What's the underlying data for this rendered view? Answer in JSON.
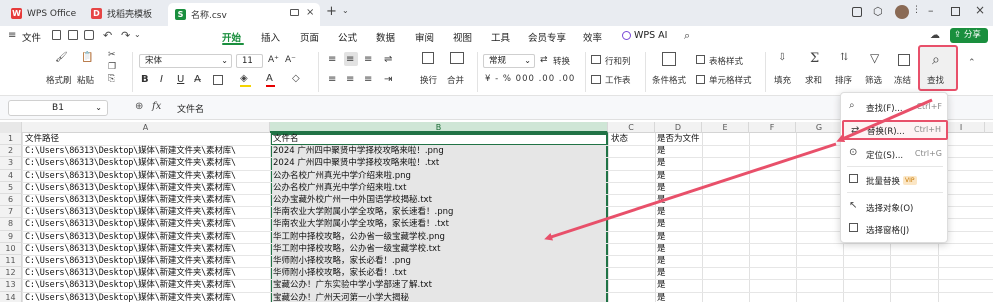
{
  "tabs": [
    {
      "label": "WPS Office"
    },
    {
      "label": "找稻壳模板"
    },
    {
      "label": "名称.csv"
    }
  ],
  "menu": {
    "file": "文件",
    "items": [
      "开始",
      "插入",
      "页面",
      "公式",
      "数据",
      "审阅",
      "视图",
      "工具",
      "会员专享",
      "效率",
      "WPS AI"
    ],
    "share": "分享"
  },
  "ribbon": {
    "format_painter": "格式刷",
    "paste": "粘贴",
    "font_name": "宋体",
    "font_size": "11",
    "wrap": "换行",
    "merge": "合并",
    "number_format": "常规",
    "convert": "转换",
    "percent_symbols": "¥ - % 000 .00 .00",
    "row_col": "行和列",
    "worksheet": "工作表",
    "conditional_format": "条件格式",
    "table_style": "表格样式",
    "cell_style": "单元格样式",
    "fill": "填充",
    "sum": "求和",
    "sort": "排序",
    "filter": "筛选",
    "freeze": "冻结",
    "find": "查找"
  },
  "formula_bar": {
    "cell_ref": "B1",
    "fx": "fx",
    "content": "文件名"
  },
  "columns": [
    "A",
    "B",
    "C",
    "D",
    "E",
    "F",
    "G",
    "H",
    "I"
  ],
  "rows": [
    {
      "n": "1",
      "a": "文件路径",
      "b": "文件名",
      "c": "状态",
      "d": "是否为文件"
    },
    {
      "n": "2",
      "a": "C:\\Users\\86313\\Desktop\\媒体\\新建文件夹\\素材库\\",
      "b": "2024 广州四中聚贤中学择校攻略来啦！.png",
      "c": "",
      "d": "是"
    },
    {
      "n": "3",
      "a": "C:\\Users\\86313\\Desktop\\媒体\\新建文件夹\\素材库\\",
      "b": "2024 广州四中聚贤中学择校攻略来啦！.txt",
      "c": "",
      "d": "是"
    },
    {
      "n": "4",
      "a": "C:\\Users\\86313\\Desktop\\媒体\\新建文件夹\\素材库\\",
      "b": "公办名校广州真光中学介绍来啦.png",
      "c": "",
      "d": "是"
    },
    {
      "n": "5",
      "a": "C:\\Users\\86313\\Desktop\\媒体\\新建文件夹\\素材库\\",
      "b": "公办名校广州真光中学介绍来啦.txt",
      "c": "",
      "d": "是"
    },
    {
      "n": "6",
      "a": "C:\\Users\\86313\\Desktop\\媒体\\新建文件夹\\素材库\\",
      "b": "公办宝藏外校广州一中外国语学校揭秘.txt",
      "c": "",
      "d": "是"
    },
    {
      "n": "7",
      "a": "C:\\Users\\86313\\Desktop\\媒体\\新建文件夹\\素材库\\",
      "b": "华南农业大学附属小学全攻略，家长速看！.png",
      "c": "",
      "d": "是"
    },
    {
      "n": "8",
      "a": "C:\\Users\\86313\\Desktop\\媒体\\新建文件夹\\素材库\\",
      "b": "华南农业大学附属小学全攻略，家长速看！.txt",
      "c": "",
      "d": "是"
    },
    {
      "n": "9",
      "a": "C:\\Users\\86313\\Desktop\\媒体\\新建文件夹\\素材库\\",
      "b": "华工附中择校攻略，公办省一级宝藏学校.png",
      "c": "",
      "d": "是"
    },
    {
      "n": "10",
      "a": "C:\\Users\\86313\\Desktop\\媒体\\新建文件夹\\素材库\\",
      "b": "华工附中择校攻略，公办省一级宝藏学校.txt",
      "c": "",
      "d": "是"
    },
    {
      "n": "11",
      "a": "C:\\Users\\86313\\Desktop\\媒体\\新建文件夹\\素材库\\",
      "b": "华师附小择校攻略，家长必看！.png",
      "c": "",
      "d": "是"
    },
    {
      "n": "12",
      "a": "C:\\Users\\86313\\Desktop\\媒体\\新建文件夹\\素材库\\",
      "b": "华师附小择校攻略，家长必看！.txt",
      "c": "",
      "d": "是"
    },
    {
      "n": "13",
      "a": "C:\\Users\\86313\\Desktop\\媒体\\新建文件夹\\素材库\\",
      "b": "宝藏公办！广东实验中学小学部速了解.txt",
      "c": "",
      "d": "是"
    },
    {
      "n": "14",
      "a": "C:\\Users\\86313\\Desktop\\媒体\\新建文件夹\\素材库\\",
      "b": "宝藏公办！广州天河第一小学大揭秘",
      "c": "",
      "d": "是"
    }
  ],
  "dropdown": [
    {
      "label": "查找(F)...",
      "shortcut": "Ctrl+F",
      "icon": "search-icon"
    },
    {
      "label": "替换(R)...",
      "shortcut": "Ctrl+H",
      "icon": "replace-icon"
    },
    {
      "label": "定位(S)...",
      "shortcut": "Ctrl+G",
      "icon": "locate-icon"
    },
    {
      "label": "批量替换",
      "shortcut": "",
      "icon": "batch-replace-icon",
      "badge": "VIP"
    },
    {
      "label": "选择对象(O)",
      "shortcut": "",
      "icon": "select-object-icon"
    },
    {
      "label": "选择窗格(J)",
      "shortcut": "",
      "icon": "selection-pane-icon"
    }
  ],
  "colors": {
    "accent_green": "#1a8f3e",
    "highlight_red": "#e8506a",
    "selection_green": "#217346"
  }
}
